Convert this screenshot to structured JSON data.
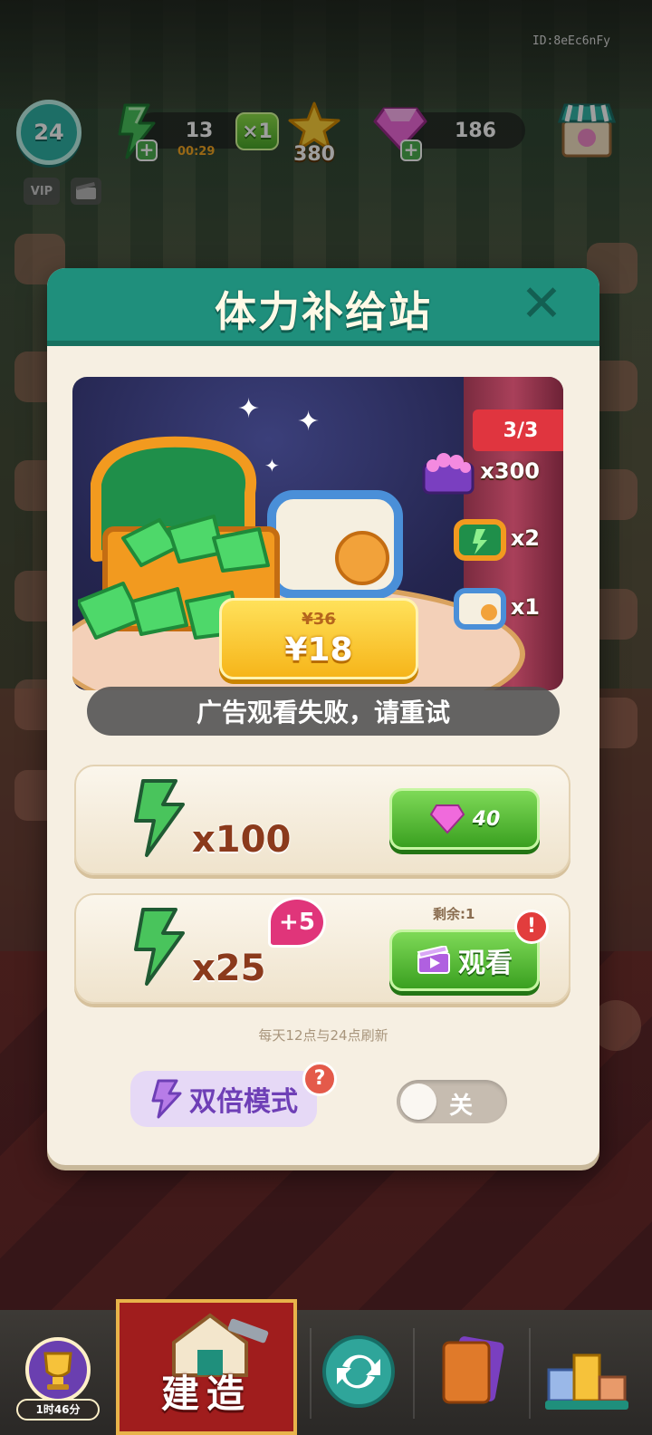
{
  "hud": {
    "level": "24",
    "vip": "VIP",
    "energy": "13",
    "energy_timer": "00:29",
    "multiplier": "×1",
    "stars": "380",
    "gems": "186",
    "player_id": "ID:8eEc6nFy"
  },
  "modal": {
    "title": "体力补给站",
    "banner": {
      "tag": "3/3",
      "rewards": [
        {
          "icon": "gem-chest-icon",
          "qty": "x300"
        },
        {
          "icon": "green-chest-icon",
          "qty": "x2"
        },
        {
          "icon": "blue-chest-icon",
          "qty": "x1"
        }
      ],
      "price_old": "¥36",
      "price_new": "¥18"
    },
    "toast": "广告观看失败，请重试",
    "offers": [
      {
        "qty": "x100",
        "button_cost": "40",
        "button_icon": "gem-icon"
      },
      {
        "qty": "x25",
        "bonus": "+5",
        "remaining": "剩余:1",
        "button_label": "观看",
        "button_icon": "video-icon",
        "alert": "!"
      }
    ],
    "refresh_note": "每天12点与24点刷新",
    "double_mode": {
      "label": "双倍模式",
      "help": "?"
    },
    "toggle": {
      "state": "关",
      "on": false
    }
  },
  "bottom_nav": {
    "trophy_timer": "1时46分",
    "build_label": "建造"
  },
  "colors": {
    "header_teal": "#1f8f7c",
    "panel_bg": "#f6efe2",
    "green_button": "#3aa020",
    "price_yellow": "#f6b51a",
    "alert_red": "#e23d3d",
    "double_purple": "#6e3fb6"
  }
}
